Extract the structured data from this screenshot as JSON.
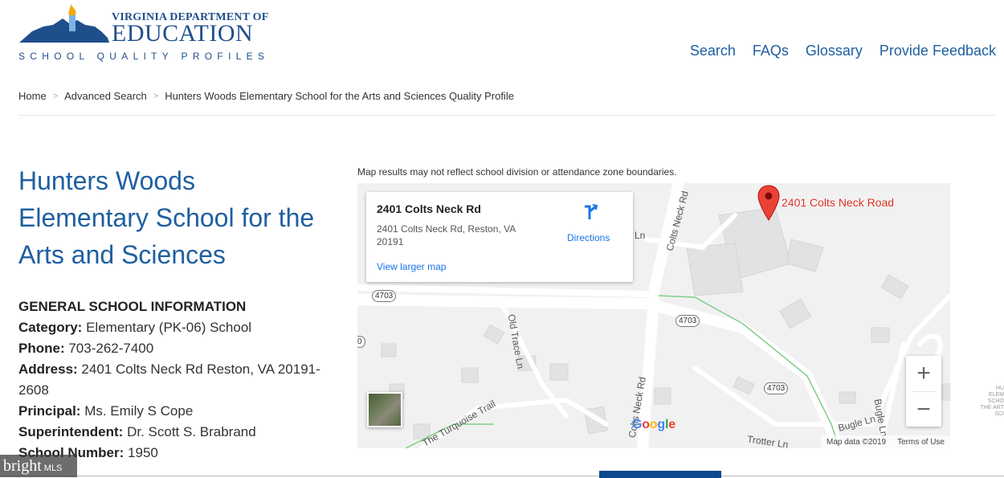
{
  "logo": {
    "line1": "VIRGINIA DEPARTMENT OF",
    "line2": "EDUCATION",
    "line3": "SCHOOL QUALITY PROFILES"
  },
  "nav": [
    "Search",
    "FAQs",
    "Glossary",
    "Provide Feedback"
  ],
  "breadcrumb": [
    "Home",
    "Advanced Search",
    "Hunters Woods Elementary School for the Arts and Sciences Quality Profile"
  ],
  "school": {
    "name": "Hunters Woods Elementary School for the Arts and Sciences",
    "section_heading": "GENERAL SCHOOL INFORMATION",
    "category_label": "Category:",
    "category": "Elementary (PK-06) School",
    "phone_label": "Phone:",
    "phone": "703-262-7400",
    "address_label": "Address:",
    "address": "2401 Colts Neck Rd Reston, VA 20191-2608",
    "principal_label": "Principal:",
    "principal": "Ms. Emily S Cope",
    "superintendent_label": "Superintendent:",
    "superintendent": "Dr. Scott S. Brabrand",
    "school_number_label": "School Number:",
    "school_number": "1950"
  },
  "map": {
    "note": "Map results may not reflect school division or attendance zone boundaries.",
    "card_title": "2401 Colts Neck Rd",
    "card_address": "2401 Colts Neck Rd, Reston, VA 20191",
    "view_larger": "View larger map",
    "directions": "Directions",
    "pin_label": "2401 Colts Neck Road",
    "zoom_in": "+",
    "zoom_out": "−",
    "attribution_data": "Map data ©2019",
    "terms": "Terms of Use",
    "google": [
      "G",
      "o",
      "o",
      "g",
      "l",
      "e"
    ],
    "google_colors": [
      "#4285f4",
      "#ea4335",
      "#fbbc05",
      "#4285f4",
      "#34a853",
      "#ea4335"
    ],
    "roads": {
      "colts_neck_upper": "Colts Neck Rd",
      "colts_neck_lower": "Colts Neck Rd",
      "old_trace": "Old Trace Ln",
      "turquoise": "The Turquoise Trail",
      "bugle": "Bugle Ln",
      "bugle_ln2": "Bugle Ln",
      "trotter": "Trotter Ln",
      "ln_fragment": "Ln",
      "route_4703_a": "4703",
      "route_4703_b": "4703",
      "route_4703_c": "4703",
      "route_edge": "0"
    }
  },
  "watermark": {
    "brand": "bright",
    "suffix": "MLS"
  },
  "edge_text": "HU ELEM SCHO THE ART SCI"
}
